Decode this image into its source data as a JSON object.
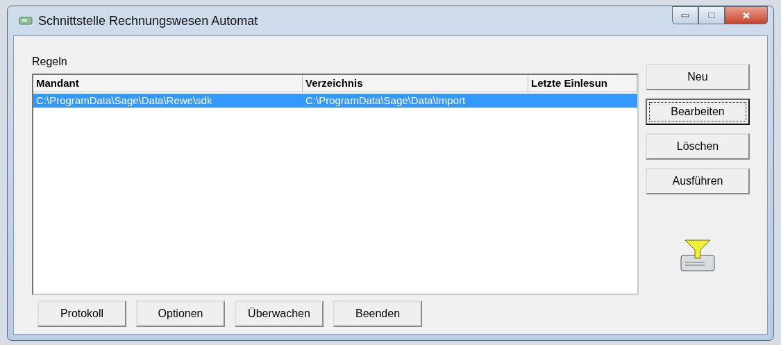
{
  "window": {
    "title": "Schnittstelle Rechnungswesen Automat"
  },
  "list_label": "Regeln",
  "table": {
    "columns": [
      "Mandant",
      "Verzeichnis",
      "Letzte Einlesun"
    ],
    "rows": [
      {
        "cells": [
          "C:\\ProgramData\\Sage\\Data\\Rewe\\sdk",
          "C:\\ProgramData\\Sage\\Data\\Import",
          ""
        ],
        "selected": true
      }
    ]
  },
  "side_buttons": [
    {
      "label": "Neu",
      "focused": false
    },
    {
      "label": "Bearbeiten",
      "focused": true
    },
    {
      "label": "Löschen",
      "focused": false
    },
    {
      "label": "Ausführen",
      "focused": false
    }
  ],
  "bottom_buttons": [
    {
      "label": "Protokoll",
      "focused": false
    },
    {
      "label": "Optionen",
      "focused": false
    },
    {
      "label": "Überwachen",
      "focused": false
    },
    {
      "label": "Beenden",
      "focused": false
    }
  ]
}
